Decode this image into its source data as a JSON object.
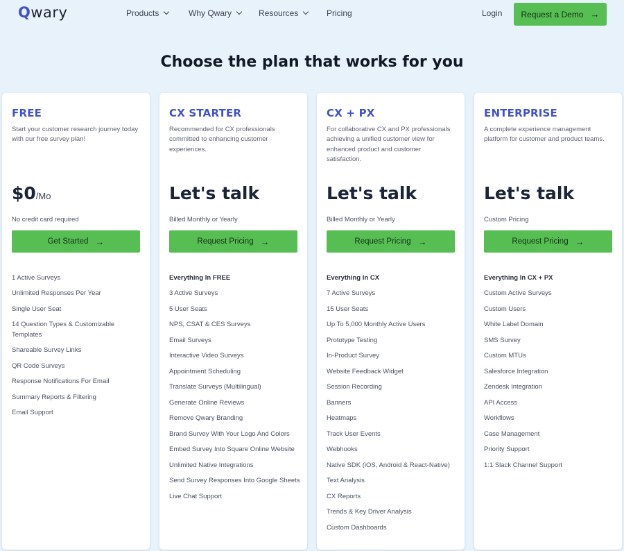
{
  "nav": {
    "logo_q": "Q",
    "logo_rest": "wary",
    "items": [
      {
        "label": "Products",
        "has_dropdown": true
      },
      {
        "label": "Why Qwary",
        "has_dropdown": true
      },
      {
        "label": "Resources",
        "has_dropdown": true
      },
      {
        "label": "Pricing",
        "has_dropdown": false
      }
    ],
    "login_label": "Login",
    "demo_label": "Request a Demo",
    "arrow_icon": "→"
  },
  "page_title": "Choose the plan that works for you",
  "colors": {
    "background": "#e8f2fa",
    "accent_blue": "#4152c8",
    "cta_green": "#57be54",
    "heading_dark": "#1b2537"
  },
  "plans": [
    {
      "name": "FREE",
      "description": "Start your customer research journey today with our free survey plan!",
      "price": "$0",
      "price_suffix": "/Mo",
      "price_note": "No credit card required",
      "cta_label": "Get Started",
      "features": [
        "1 Active Surveys",
        "Unlimited Responses Per Year",
        "Single User Seat",
        "14 Question Types & Customizable Templates",
        "Shareable Survey Links",
        "QR Code Surveys",
        "Response Notifications For Email",
        "Summary Reports & Filtering",
        "Email Support"
      ]
    },
    {
      "name": "CX STARTER",
      "description": "Recommended for CX professionals committed to enhancing customer experiences.",
      "price": "Let's talk",
      "price_suffix": "",
      "price_note": "Billed Monthly or Yearly",
      "cta_label": "Request Pricing",
      "features_heading": "Everything In FREE",
      "features": [
        "3 Active Surveys",
        "5 User Seats",
        "NPS, CSAT & CES Surveys",
        "Email Surveys",
        "Interactive Video Surveys",
        "Appointment Scheduling",
        "Translate Surveys (Multilingual)",
        "Generate Online Reviews",
        "Remove Qwary Branding",
        "Brand Survey With Your Logo And Colors",
        "Embed Survey Into Square Online Website",
        "Unlimited Native Integrations",
        "Send Survey Responses Into Google Sheets",
        "Live Chat Support"
      ]
    },
    {
      "name": "CX + PX",
      "description": "For collaborative CX and PX professionals achieving a unified customer view for enhanced product and customer satisfaction.",
      "price": "Let's talk",
      "price_suffix": "",
      "price_note": "Billed Monthly or Yearly",
      "cta_label": "Request Pricing",
      "features_heading": "Everything In CX",
      "features": [
        "7 Active Surveys",
        "15 User Seats",
        "Up To 5,000 Monthly Active Users",
        "Prototype Testing",
        "In-Product Survey",
        "Website Feedback Widget",
        "Session Recording",
        "Banners",
        "Heatmaps",
        "Track User Events",
        "Webhooks",
        "Native SDK (iOS, Android & React-Native)",
        "Text Analysis",
        "CX Reports",
        "Trends & Key Driver Analysis",
        "Custom Dashboards"
      ]
    },
    {
      "name": "ENTERPRISE",
      "description": "A complete experience management platform for customer and product teams.",
      "price": "Let's talk",
      "price_suffix": "",
      "price_note": "Custom Pricing",
      "cta_label": "Request Pricing",
      "features_heading": "Everything In CX + PX",
      "features": [
        "Custom Active Surveys",
        "Custom Users",
        "White Label Domain",
        "SMS Survey",
        "Custom MTUs",
        "Salesforce Integration",
        "Zendesk Integration",
        "API Access",
        "Workflows",
        "Case Management",
        "Priority Support",
        "1:1 Slack Channel Support"
      ]
    }
  ]
}
